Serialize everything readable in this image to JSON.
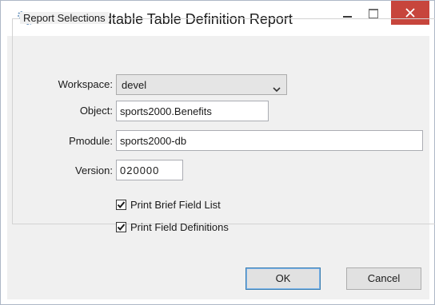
{
  "window": {
    "title": "Roundtable Table Definition Report"
  },
  "group": {
    "legend": "Report Selections"
  },
  "form": {
    "workspace_label": "Workspace:",
    "workspace_value": "devel",
    "object_label": "Object:",
    "object_value": "sports2000.Benefits",
    "pmodule_label": "Pmodule:",
    "pmodule_value": "sports2000-db",
    "version_label": "Version:",
    "version_value": "020000"
  },
  "options": {
    "print_brief_label": "Print Brief Field List",
    "print_brief_checked": true,
    "print_definitions_label": "Print Field Definitions",
    "print_definitions_checked": true
  },
  "buttons": {
    "ok_label": "OK",
    "cancel_label": "Cancel"
  },
  "colors": {
    "close_button": "#c7453c",
    "dialog_background": "#f0f0f0",
    "default_button_border": "#3c7fb1"
  },
  "icons": {
    "app": "roundtable-gears-icon",
    "minimize": "minimize-icon",
    "maximize": "maximize-icon",
    "close": "close-icon",
    "dropdown": "chevron-down-icon",
    "check": "checkmark-icon"
  }
}
